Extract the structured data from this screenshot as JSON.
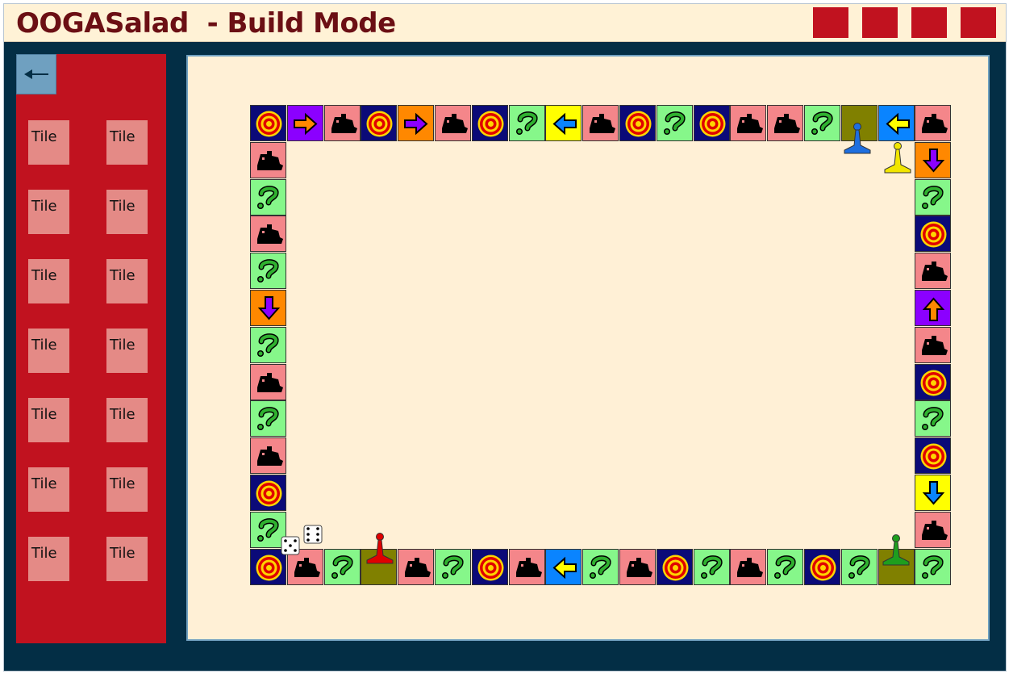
{
  "window": {
    "title": "OOGASalad  - Build Mode",
    "title_color": "#6B0F14",
    "titlebar_bg": "#FFF2D6",
    "buttons": [
      {
        "name": "window-button-1"
      },
      {
        "name": "window-button-2"
      },
      {
        "name": "window-button-3"
      },
      {
        "name": "window-button-4"
      }
    ]
  },
  "sidebar": {
    "back_icon": "arrow-left-icon",
    "tiles": [
      "Tile",
      "Tile",
      "Tile",
      "Tile",
      "Tile",
      "Tile",
      "Tile",
      "Tile",
      "Tile",
      "Tile",
      "Tile",
      "Tile",
      "Tile",
      "Tile"
    ]
  },
  "colors": {
    "app_bg": "#032E45",
    "sidebar_bg": "#C1121F",
    "palette_tile": "#E48A86",
    "canvas_bg": "#FFF0D6",
    "tile_salmon": "#F4868A",
    "tile_green": "#86F78A",
    "tile_navy": "#0B0A78",
    "tile_purple": "#8B00FF",
    "tile_orange": "#FF8800",
    "tile_blue": "#0A84FF",
    "tile_yellow": "#FFFF00",
    "tile_olive": "#808000"
  },
  "board": {
    "top_row": [
      {
        "bg": "navy",
        "icon": "target"
      },
      {
        "bg": "purple",
        "icon": "arrow-right-orange"
      },
      {
        "bg": "salmon",
        "icon": "ship"
      },
      {
        "bg": "navy",
        "icon": "target"
      },
      {
        "bg": "orange",
        "icon": "arrow-right-purple"
      },
      {
        "bg": "salmon",
        "icon": "ship"
      },
      {
        "bg": "navy",
        "icon": "target"
      },
      {
        "bg": "green",
        "icon": "question"
      },
      {
        "bg": "yellow",
        "icon": "arrow-left-blue"
      },
      {
        "bg": "salmon",
        "icon": "ship"
      },
      {
        "bg": "navy",
        "icon": "target"
      },
      {
        "bg": "green",
        "icon": "question"
      },
      {
        "bg": "navy",
        "icon": "target"
      },
      {
        "bg": "salmon",
        "icon": "ship"
      },
      {
        "bg": "salmon",
        "icon": "ship"
      },
      {
        "bg": "green",
        "icon": "question"
      },
      {
        "bg": "olive",
        "icon": "none"
      },
      {
        "bg": "blue",
        "icon": "arrow-left-yellow"
      },
      {
        "bg": "salmon",
        "icon": "ship"
      }
    ],
    "right_col": [
      {
        "bg": "orange",
        "icon": "arrow-down-purple"
      },
      {
        "bg": "green",
        "icon": "question"
      },
      {
        "bg": "navy",
        "icon": "target"
      },
      {
        "bg": "salmon",
        "icon": "ship"
      },
      {
        "bg": "purple",
        "icon": "arrow-up-orange"
      },
      {
        "bg": "salmon",
        "icon": "ship"
      },
      {
        "bg": "navy",
        "icon": "target"
      },
      {
        "bg": "green",
        "icon": "question"
      },
      {
        "bg": "navy",
        "icon": "target"
      },
      {
        "bg": "yellow",
        "icon": "arrow-down-blue"
      },
      {
        "bg": "salmon",
        "icon": "ship"
      }
    ],
    "bottom_row": [
      {
        "bg": "navy",
        "icon": "target"
      },
      {
        "bg": "salmon",
        "icon": "ship"
      },
      {
        "bg": "green",
        "icon": "question"
      },
      {
        "bg": "olive",
        "icon": "none"
      },
      {
        "bg": "salmon",
        "icon": "ship"
      },
      {
        "bg": "green",
        "icon": "question"
      },
      {
        "bg": "navy",
        "icon": "target"
      },
      {
        "bg": "salmon",
        "icon": "ship"
      },
      {
        "bg": "blue",
        "icon": "arrow-left-yellow"
      },
      {
        "bg": "green",
        "icon": "question"
      },
      {
        "bg": "salmon",
        "icon": "ship"
      },
      {
        "bg": "navy",
        "icon": "target"
      },
      {
        "bg": "green",
        "icon": "question"
      },
      {
        "bg": "salmon",
        "icon": "ship"
      },
      {
        "bg": "green",
        "icon": "question"
      },
      {
        "bg": "navy",
        "icon": "target"
      },
      {
        "bg": "green",
        "icon": "question"
      },
      {
        "bg": "olive",
        "icon": "none"
      },
      {
        "bg": "green",
        "icon": "question"
      }
    ],
    "left_col": [
      {
        "bg": "salmon",
        "icon": "ship"
      },
      {
        "bg": "green",
        "icon": "question"
      },
      {
        "bg": "salmon",
        "icon": "ship"
      },
      {
        "bg": "green",
        "icon": "question"
      },
      {
        "bg": "orange",
        "icon": "arrow-down-purple"
      },
      {
        "bg": "green",
        "icon": "question"
      },
      {
        "bg": "salmon",
        "icon": "ship"
      },
      {
        "bg": "green",
        "icon": "question"
      },
      {
        "bg": "salmon",
        "icon": "ship"
      },
      {
        "bg": "navy",
        "icon": "target"
      },
      {
        "bg": "green",
        "icon": "question"
      }
    ],
    "pieces": [
      {
        "name": "blue-pawn-icon",
        "color": "#1E6FE0"
      },
      {
        "name": "yellow-pawn-icon",
        "color": "#F2E600"
      },
      {
        "name": "red-pawn-icon",
        "color": "#E00000"
      },
      {
        "name": "green-pawn-icon",
        "color": "#1E9E1E"
      }
    ],
    "dice": [
      {
        "name": "dice-icon",
        "face": 5
      },
      {
        "name": "dice-icon",
        "face": 6
      }
    ]
  }
}
